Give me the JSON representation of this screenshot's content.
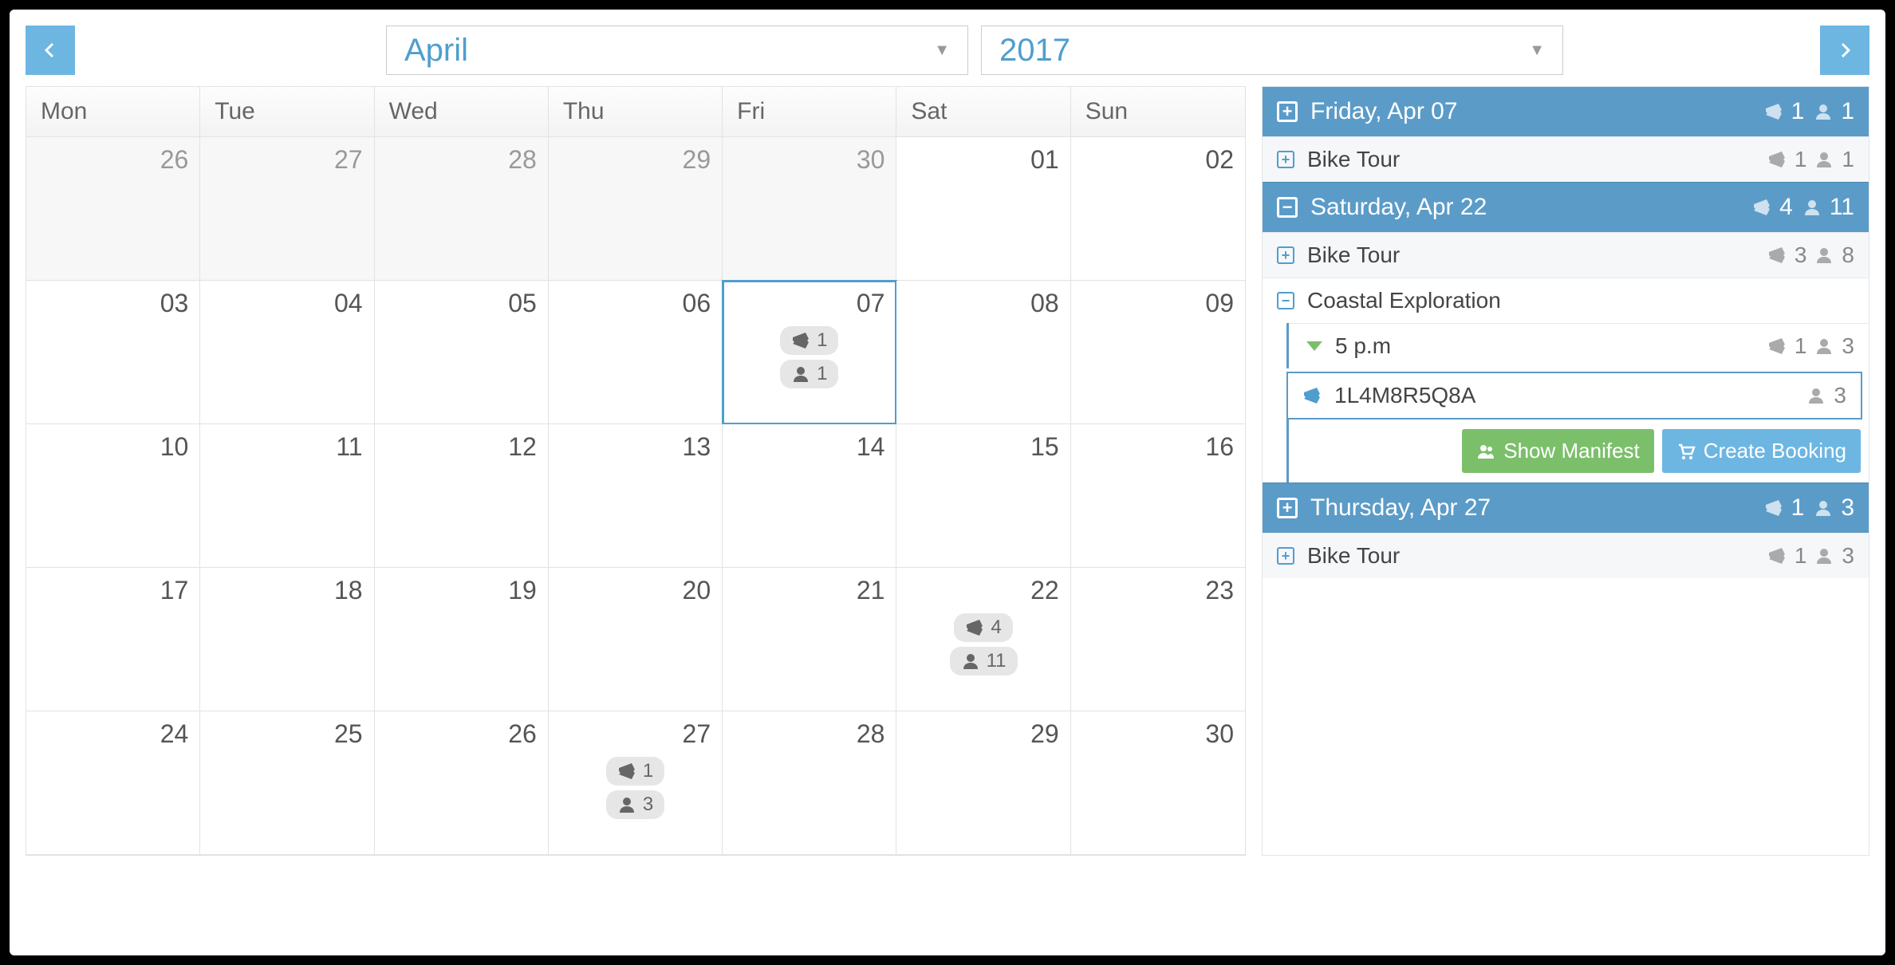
{
  "nav": {
    "month": "April",
    "year": "2017"
  },
  "calendar": {
    "headers": [
      "Mon",
      "Tue",
      "Wed",
      "Thu",
      "Fri",
      "Sat",
      "Sun"
    ],
    "cells": [
      {
        "d": "26",
        "prev": true
      },
      {
        "d": "27",
        "prev": true
      },
      {
        "d": "28",
        "prev": true
      },
      {
        "d": "29",
        "prev": true
      },
      {
        "d": "30",
        "prev": true
      },
      {
        "d": "01"
      },
      {
        "d": "02"
      },
      {
        "d": "03"
      },
      {
        "d": "04"
      },
      {
        "d": "05"
      },
      {
        "d": "06"
      },
      {
        "d": "07",
        "selected": true,
        "tickets": "1",
        "people": "1"
      },
      {
        "d": "08"
      },
      {
        "d": "09"
      },
      {
        "d": "10"
      },
      {
        "d": "11"
      },
      {
        "d": "12"
      },
      {
        "d": "13"
      },
      {
        "d": "14"
      },
      {
        "d": "15"
      },
      {
        "d": "16"
      },
      {
        "d": "17"
      },
      {
        "d": "18"
      },
      {
        "d": "19"
      },
      {
        "d": "20"
      },
      {
        "d": "21"
      },
      {
        "d": "22",
        "tickets": "4",
        "people": "11"
      },
      {
        "d": "23"
      },
      {
        "d": "24"
      },
      {
        "d": "25"
      },
      {
        "d": "26"
      },
      {
        "d": "27",
        "tickets": "1",
        "people": "3"
      },
      {
        "d": "28"
      },
      {
        "d": "29"
      },
      {
        "d": "30"
      }
    ]
  },
  "panel": {
    "d0": {
      "title": "Friday, Apr 07",
      "tickets": "1",
      "people": "1",
      "exp": "plus",
      "p0": {
        "name": "Bike Tour",
        "tickets": "1",
        "people": "1"
      }
    },
    "d1": {
      "title": "Saturday, Apr 22",
      "tickets": "4",
      "people": "11",
      "exp": "minus",
      "p0": {
        "name": "Bike Tour",
        "tickets": "3",
        "people": "8"
      },
      "p1": {
        "name": "Coastal Exploration",
        "t0": {
          "time": "5 p.m",
          "tickets": "1",
          "people": "3",
          "b0": {
            "code": "1L4M8R5Q8A",
            "people": "3"
          }
        }
      }
    },
    "d2": {
      "title": "Thursday, Apr 27",
      "tickets": "1",
      "people": "3",
      "exp": "plus",
      "p0": {
        "name": "Bike Tour",
        "tickets": "1",
        "people": "3"
      }
    }
  },
  "actions": {
    "manifest": "Show Manifest",
    "create": "Create Booking"
  }
}
